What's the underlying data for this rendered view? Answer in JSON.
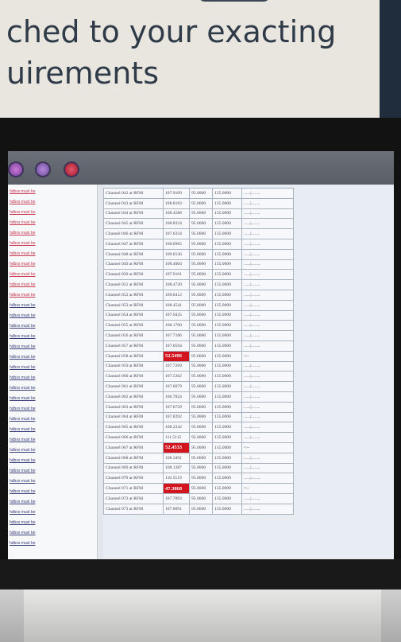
{
  "poster": {
    "line1": "ched to your exacting",
    "line2": "uirements"
  },
  "toolbar": {
    "buttons": [
      {
        "label": "",
        "icon": "record-icon"
      },
      {
        "label": "",
        "icon": "user-icon"
      },
      {
        "label": "",
        "icon": "home-icon"
      }
    ]
  },
  "left_items": [
    "hdbxs must be",
    "hdbxs must be",
    "hdbxs must be",
    "hdbxs must be",
    "hdbxs must be",
    "hdbxs must be",
    "hdbxs must be",
    "hdbxs must be",
    "hdbxs must be",
    "hdbxs must be",
    "hdbxs must be",
    "hdbxs must be",
    "hdbxs must be",
    "hdbxs must be",
    "hdbxs must be",
    "hdbxs must be",
    "hdbxs must be",
    "hdbxs must be",
    "hdbxs must be",
    "hdbxs must be",
    "hdbxs must be",
    "hdbxs must be",
    "hdbxs must be",
    "hdbxs must be",
    "hdbxs must be",
    "hdbxs must be",
    "hdbxs must be",
    "hdbxs must be",
    "hdbxs must be",
    "hdbxs must be",
    "hdbxs must be",
    "hdbxs must be",
    "hdbxs must be",
    "hdbxs must be",
    "hdbxs must be"
  ],
  "table": {
    "rows": [
      [
        "Channel 042 at RFM",
        "107.9109",
        "95.0000",
        "135.0000",
        "......|........"
      ],
      [
        "Channel 043 at RFM",
        "108.8183",
        "95.0000",
        "135.0000",
        "......|........"
      ],
      [
        "Channel 044 at RFM",
        "108.4588",
        "95.0000",
        "135.0000",
        "......|........"
      ],
      [
        "Channel 045 at RFM",
        "108.8324",
        "95.0000",
        "135.0000",
        "......|........"
      ],
      [
        "Channel 046 at RFM",
        "107.6334",
        "95.0000",
        "135.0000",
        "......|........"
      ],
      [
        "Channel 047 at RFM",
        "108.6965",
        "95.0000",
        "135.0000",
        "......|........"
      ],
      [
        "Channel 048 at RFM",
        "109.0136",
        "95.0000",
        "135.0000",
        "......|........"
      ],
      [
        "Channel 049 at RFM",
        "108.4004",
        "95.0000",
        "135.0000",
        "......|........"
      ],
      [
        "Channel 050 at RFM",
        "107.9161",
        "95.0000",
        "135.0000",
        "......|........"
      ],
      [
        "Channel 051 at RFM",
        "108.4720",
        "95.0000",
        "135.0000",
        "......|........"
      ],
      [
        "Channel 052 at RFM",
        "109.0412",
        "95.0000",
        "135.0000",
        "......|........"
      ],
      [
        "Channel 053 at RFM",
        "108.4541",
        "95.0000",
        "135.0000",
        "......|........"
      ],
      [
        "Channel 054 at RFM",
        "107.9435",
        "95.0000",
        "135.0000",
        "......|........"
      ],
      [
        "Channel 055 at RFM",
        "108.1760",
        "95.0000",
        "135.0000",
        "......|........"
      ],
      [
        "Channel 056 at RFM",
        "107.7186",
        "95.0000",
        "135.0000",
        "......|........"
      ],
      [
        "Channel 057 at RFM",
        "107.6594",
        "95.0000",
        "135.0000",
        "......|........"
      ],
      [
        "Channel 058 at RFM",
        "52.5496",
        "95.0000",
        "135.0000",
        "<--"
      ],
      [
        "Channel 059 at RFM",
        "107.7269",
        "95.0000",
        "135.0000",
        "......|........"
      ],
      [
        "Channel 060 at RFM",
        "107.5362",
        "95.0000",
        "135.0000",
        "......|........"
      ],
      [
        "Channel 061 at RFM",
        "107.6079",
        "95.0000",
        "135.0000",
        "......|........"
      ],
      [
        "Channel 062 at RFM",
        "106.7824",
        "95.0000",
        "135.0000",
        "......|........"
      ],
      [
        "Channel 063 at RFM",
        "107.6729",
        "95.0000",
        "135.0000",
        "......|........"
      ],
      [
        "Channel 064 at RFM",
        "107.8392",
        "95.0000",
        "135.0000",
        "......|........"
      ],
      [
        "Channel 065 at RFM",
        "108.2242",
        "95.0000",
        "135.0000",
        "......|........"
      ],
      [
        "Channel 066 at RFM",
        "111.5115",
        "95.0000",
        "135.0000",
        "......|........"
      ],
      [
        "Channel 067 at RFM",
        "52.4533",
        "95.0000",
        "135.0000",
        "<--"
      ],
      [
        "Channel 068 at RFM",
        "108.3491",
        "95.0000",
        "135.0000",
        "......|........"
      ],
      [
        "Channel 069 at RFM",
        "108.1387",
        "95.0000",
        "135.0000",
        "......|........"
      ],
      [
        "Channel 070 at RFM",
        "110.5519",
        "95.0000",
        "135.0000",
        "......|........"
      ],
      [
        "Channel 071 at RFM",
        "47.3868",
        "95.0000",
        "135.0000",
        "<--"
      ],
      [
        "Channel 072 at RFM",
        "107.7893",
        "95.0000",
        "135.0000",
        "......|........"
      ],
      [
        "Channel 073 at RFM",
        "107.8091",
        "95.0000",
        "135.0000",
        "......|........"
      ]
    ],
    "highlight_color": "#d1141d"
  }
}
